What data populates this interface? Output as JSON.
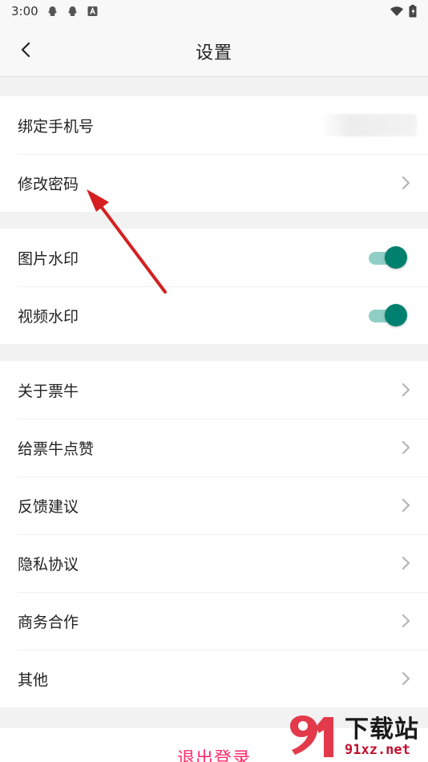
{
  "status_bar": {
    "time": "3:00",
    "left_icons": [
      "qq-icon",
      "qq-icon",
      "a-badge-icon"
    ],
    "right_icons": [
      "wifi-icon",
      "battery-icon"
    ]
  },
  "header": {
    "title": "设置"
  },
  "groups": [
    {
      "items": [
        {
          "label": "绑定手机号",
          "value": ""
        },
        {
          "label": "修改密码"
        }
      ]
    },
    {
      "items": [
        {
          "label": "图片水印",
          "toggle": true
        },
        {
          "label": "视频水印",
          "toggle": true
        }
      ]
    },
    {
      "items": [
        {
          "label": "关于票牛"
        },
        {
          "label": "给票牛点赞"
        },
        {
          "label": "反馈建议"
        },
        {
          "label": "隐私协议"
        },
        {
          "label": "商务合作"
        },
        {
          "label": "其他"
        }
      ]
    }
  ],
  "logout_label": "退出登录",
  "colors": {
    "toggle_on": "#00806f",
    "toggle_track": "#8fcfc6",
    "logout": "#ff2b6a",
    "annotation_arrow": "#d42020"
  },
  "watermark": {
    "text_cn": "下载站",
    "text_en": "91xz.net"
  }
}
